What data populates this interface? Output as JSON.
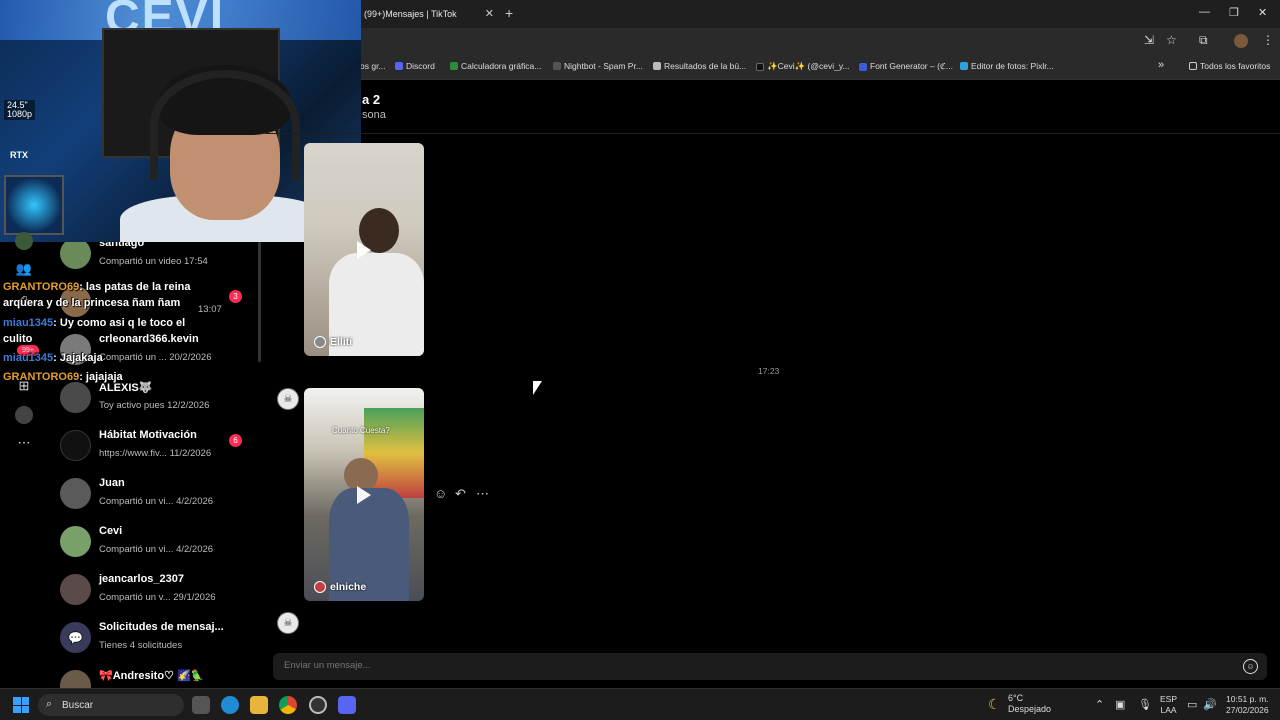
{
  "browser": {
    "tab_title": "(99+)Mensajes | TikTok",
    "tab_close": "✕",
    "new_tab": "+",
    "window_controls": [
      "—",
      "❐",
      "✕"
    ],
    "bookmarks": [
      {
        "label": "os gr...",
        "color": "#888888"
      },
      {
        "label": "Discord",
        "color": "#5865f2"
      },
      {
        "label": "Calculadora gráfica...",
        "color": "#2d8a3e"
      },
      {
        "label": "Nightbot - Spam Pr...",
        "color": "#555555"
      },
      {
        "label": "Resultados de la bú...",
        "color": "#bbbbbb"
      },
      {
        "label": "✨Cevi✨ (@cevi_y...",
        "color": "#111111"
      },
      {
        "label": "Font Generator – (ℭ...",
        "color": "#3b5bdb"
      },
      {
        "label": "Editor de fotos: Pixlr...",
        "color": "#2aa4e0"
      }
    ],
    "bookmarks_more": "»",
    "all_favorites": "Todos los favoritos"
  },
  "webcam": {
    "logo_text": "CEVI",
    "badge_line1": "24.5\"",
    "badge_line2": "1080p",
    "rtx_label": "RTX"
  },
  "rail_icons": [
    "profile-icon",
    "friends-icon",
    "upload-icon",
    "add-icon",
    "explore-icon",
    "more-icon"
  ],
  "conversations": [
    {
      "name": "santiago",
      "preview": "Compartió un video 17:54",
      "unread": ""
    },
    {
      "name": "",
      "preview": "13:07",
      "unread": "3"
    },
    {
      "name": "crleonard366.kevin",
      "preview": "Compartió un ...    20/2/2026",
      "unread": ""
    },
    {
      "name": "ALEXIS🐺",
      "preview": "Toy activo pues 12/2/2026",
      "unread": ""
    },
    {
      "name": "Hábitat Motivación",
      "preview": "https://www.fiv...    11/2/2026",
      "unread": "6"
    },
    {
      "name": "Juan",
      "preview": "Compartió un vi...   4/2/2026",
      "unread": ""
    },
    {
      "name": "Cevi",
      "preview": "Compartió un vi...   4/2/2026",
      "unread": ""
    },
    {
      "name": "jeancarlos_2307",
      "preview": "Compartió un v...   29/1/2026",
      "unread": ""
    },
    {
      "name": "Solicitudes de mensaj...",
      "preview": "Tienes 4 solicitudes",
      "unread": ""
    },
    {
      "name": "🎀Andresito♡ 🌠🦜",
      "preview": "",
      "unread": ""
    }
  ],
  "stream_chat": [
    {
      "user": "GRANTORO69",
      "text": ": las patas de la reina",
      "user_color": "orange"
    },
    {
      "user": "",
      "text": "arquera y de la princesa ñam ñam",
      "user_color": "none"
    },
    {
      "user": "miau1345",
      "text": ": Uy como asi q le toco el",
      "user_color": "blue"
    },
    {
      "user": "",
      "text": "culito",
      "user_color": "none"
    },
    {
      "user": "miau1345",
      "text": ": Jajakaja",
      "user_color": "blue"
    },
    {
      "user": "GRANTORO69",
      "text": ": jajajaja",
      "user_color": "orange"
    }
  ],
  "rail_badge": "99+",
  "chat": {
    "title": "a 2",
    "subtitle": "sona",
    "timestamp": "17:23",
    "video1_author": "Elliti",
    "video2_author": "elniche",
    "video2_caption": "Cuanto Cuesta?",
    "composer_placeholder": "Enviar un mensaje..."
  },
  "taskbar": {
    "search_label": "Buscar",
    "weather_temp": "6°C",
    "weather_desc": "Despejado",
    "lang_line1": "ESP",
    "lang_line2": "LAA",
    "time": "10:51 p. m.",
    "date": "27/02/2026"
  }
}
